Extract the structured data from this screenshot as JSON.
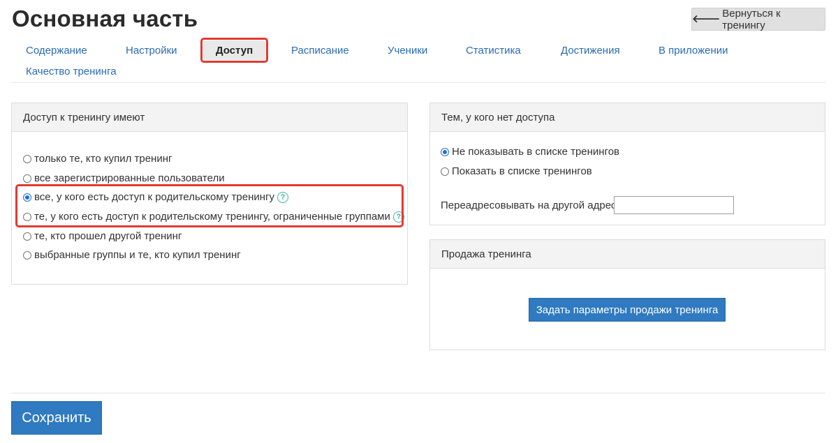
{
  "page": {
    "title": "Основная часть"
  },
  "header": {
    "back_button_label": "Вернуться к тренингу"
  },
  "tabs": [
    {
      "label": "Содержание"
    },
    {
      "label": "Настройки"
    },
    {
      "label": "Доступ"
    },
    {
      "label": "Расписание"
    },
    {
      "label": "Ученики"
    },
    {
      "label": "Статистика"
    },
    {
      "label": "Достижения"
    },
    {
      "label": "В приложении"
    },
    {
      "label": "Качество тренинга"
    }
  ],
  "access_panel": {
    "title": "Доступ к тренингу имеют",
    "options": [
      {
        "label": "только те, кто купил тренинг",
        "checked": false
      },
      {
        "label": "все зарегистрированные пользователи",
        "checked": false
      },
      {
        "label": "все, у кого есть доступ к родительскому тренингу",
        "checked": true
      },
      {
        "label": "те, у кого есть доступ к родительскому тренингу, ограниченные группами",
        "checked": false
      },
      {
        "label": "те, кто прошел другой тренинг",
        "checked": false
      },
      {
        "label": "выбранные группы и те, кто купил тренинг",
        "checked": false
      }
    ],
    "help_glyph": "?"
  },
  "no_access_panel": {
    "title": "Тем, у кого нет доступа",
    "options": [
      {
        "label": "Не показывать в списке тренингов",
        "checked": true
      },
      {
        "label": "Показать в списке тренингов",
        "checked": false
      }
    ],
    "redirect_label": "Переадресовывать на другой адрес",
    "redirect_value": ""
  },
  "sale_panel": {
    "title": "Продажа тренинга",
    "button_label": "Задать параметры продажи тренинга"
  },
  "footer": {
    "save_label": "Сохранить"
  },
  "colors": {
    "link": "#2a6bb5",
    "primary": "#2f7ac1",
    "highlight": "#e03b32",
    "help": "#37b5a9"
  }
}
